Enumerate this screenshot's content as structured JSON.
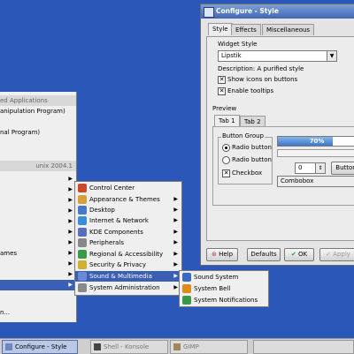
{
  "window": {
    "title": "Configure - Style",
    "tabs": [
      {
        "label": "Style",
        "active": true
      },
      {
        "label": "Effects",
        "active": false
      },
      {
        "label": "Miscellaneous",
        "active": false
      }
    ],
    "widget_style": {
      "group_label": "Widget Style",
      "selected": "Lipstik",
      "description": "Description: A purified style",
      "show_icons_label": "Show icons on buttons",
      "show_icons_checked": true,
      "enable_tooltips_label": "Enable tooltips",
      "enable_tooltips_checked": true
    },
    "preview": {
      "group_label": "Preview",
      "tabs": [
        "Tab 1",
        "Tab 2"
      ],
      "button_group_label": "Button Group",
      "radio1": "Radio button",
      "radio2": "Radio button",
      "checkbox": "Checkbox",
      "progress_text": "70%",
      "progress_value": 0.7,
      "spin_value": "0",
      "button_label": "Button",
      "combobox": "Combobox"
    },
    "buttons": {
      "help": "Help",
      "defaults": "Defaults",
      "ok": "OK",
      "apply": "Apply"
    }
  },
  "start_menu": {
    "items": [
      "ed Applications",
      "anipulation Program)",
      "nal Program)",
      "unix 2004.1",
      "ames",
      "n..."
    ]
  },
  "settings_menu": {
    "items": [
      {
        "label": "Control Center",
        "arrow": false,
        "icon": "control-center-icon",
        "color": "#c84a2a"
      },
      {
        "label": "Appearance & Themes",
        "arrow": true,
        "icon": "appearance-icon",
        "color": "#d8a03a"
      },
      {
        "label": "Desktop",
        "arrow": true,
        "icon": "desktop-icon",
        "color": "#4a78c8"
      },
      {
        "label": "Internet & Network",
        "arrow": true,
        "icon": "internet-icon",
        "color": "#3a8ed8"
      },
      {
        "label": "KDE Components",
        "arrow": true,
        "icon": "kde-components-icon",
        "color": "#5a6ec0"
      },
      {
        "label": "Peripherals",
        "arrow": true,
        "icon": "peripherals-icon",
        "color": "#888888"
      },
      {
        "label": "Regional & Accessibility",
        "arrow": true,
        "icon": "regional-icon",
        "color": "#3a9a4a"
      },
      {
        "label": "Security & Privacy",
        "arrow": true,
        "icon": "security-icon",
        "color": "#d0b030"
      },
      {
        "label": "Sound & Multimedia",
        "arrow": true,
        "icon": "sound-multimedia-icon",
        "color": "#6a8ad8",
        "selected": true
      },
      {
        "label": "System Administration",
        "arrow": true,
        "icon": "system-admin-icon",
        "color": "#8a8a8a"
      }
    ]
  },
  "sound_menu": {
    "items": [
      {
        "label": "Sound System",
        "icon": "sound-system-icon",
        "color": "#3a6ac8"
      },
      {
        "label": "System Bell",
        "icon": "bell-icon",
        "color": "#e08a1a"
      },
      {
        "label": "System Notifications",
        "icon": "notifications-icon",
        "color": "#3a9a4a"
      }
    ]
  },
  "taskbar": {
    "tasks": [
      {
        "label": "Configure - Style",
        "active": true
      },
      {
        "label": "Shell - Konsole",
        "active": false
      },
      {
        "label": "GIMP",
        "active": false
      }
    ]
  }
}
